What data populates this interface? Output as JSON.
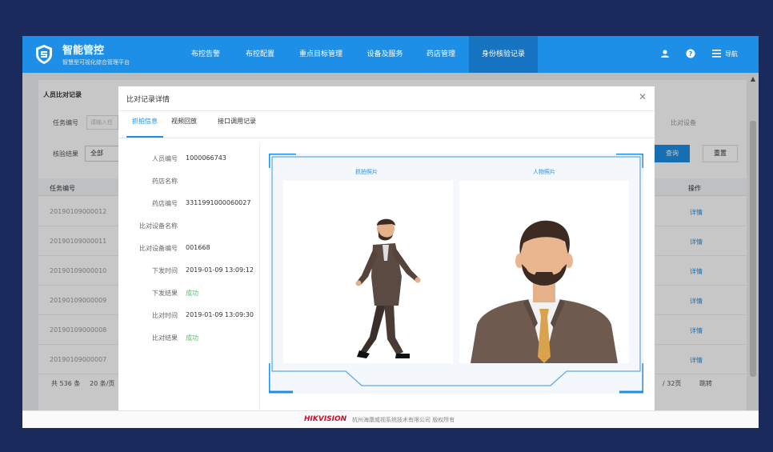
{
  "app": {
    "title": "智能管控",
    "subtitle": "智慧型可视化综合管理平台"
  },
  "nav": {
    "items": [
      "布控告警",
      "布控配置",
      "重点目标管理",
      "设备及服务",
      "药店管理",
      "身份核验记录"
    ],
    "active_index": 5,
    "right_label": "导航",
    "icons": [
      "user-icon",
      "help-icon",
      "menu-icon"
    ]
  },
  "background_page": {
    "section_title": "人员比对记录",
    "task_no_label": "任务编号",
    "task_no_placeholder": "请输入任",
    "right_placeholder": "比对设备",
    "check_result_label": "核验结果",
    "check_result_value": "全部",
    "query_button": "查询",
    "reset_button": "重置",
    "col_task_no": "任务编号",
    "col_action": "操作",
    "rows": [
      {
        "task_no": "20190109000012",
        "action": "详情"
      },
      {
        "task_no": "20190109000011",
        "action": "详情"
      },
      {
        "task_no": "20190109000010",
        "action": "详情"
      },
      {
        "task_no": "20190109000009",
        "action": "详情"
      },
      {
        "task_no": "20190109000008",
        "action": "详情"
      },
      {
        "task_no": "20190109000007",
        "action": "详情"
      }
    ],
    "total": "共 536 条",
    "page_size": "20 条/页",
    "pages": "/ 32页",
    "jump": "跳转"
  },
  "modal": {
    "title": "比对记录详情",
    "tabs": [
      "抓拍信息",
      "视频回放",
      "接口调用记录"
    ],
    "active_tab": 0,
    "fields": [
      {
        "label": "人员编号",
        "value": "1000066743"
      },
      {
        "label": "药店名称",
        "value": ""
      },
      {
        "label": "药店编号",
        "value": "3311991000060027"
      },
      {
        "label": "比对设备名称",
        "value": ""
      },
      {
        "label": "比对设备编号",
        "value": "001668"
      },
      {
        "label": "下发时间",
        "value": "2019-01-09 13:09:12"
      },
      {
        "label": "下发结果",
        "value": "成功"
      },
      {
        "label": "比对时间",
        "value": "2019-01-09 13:09:30"
      },
      {
        "label": "比对结果",
        "value": "成功"
      }
    ],
    "captions": {
      "capture": "抓拍照片",
      "person": "人物照片"
    }
  },
  "footer": {
    "brand": "HIKVISION",
    "copyright": "杭州海康威视系统技术有限公司 版权所有"
  },
  "colors": {
    "primary": "#1e8fe6",
    "active_nav": "#1674c2",
    "success": "#4cc16a",
    "outer_bg": "#1a2a5c"
  }
}
